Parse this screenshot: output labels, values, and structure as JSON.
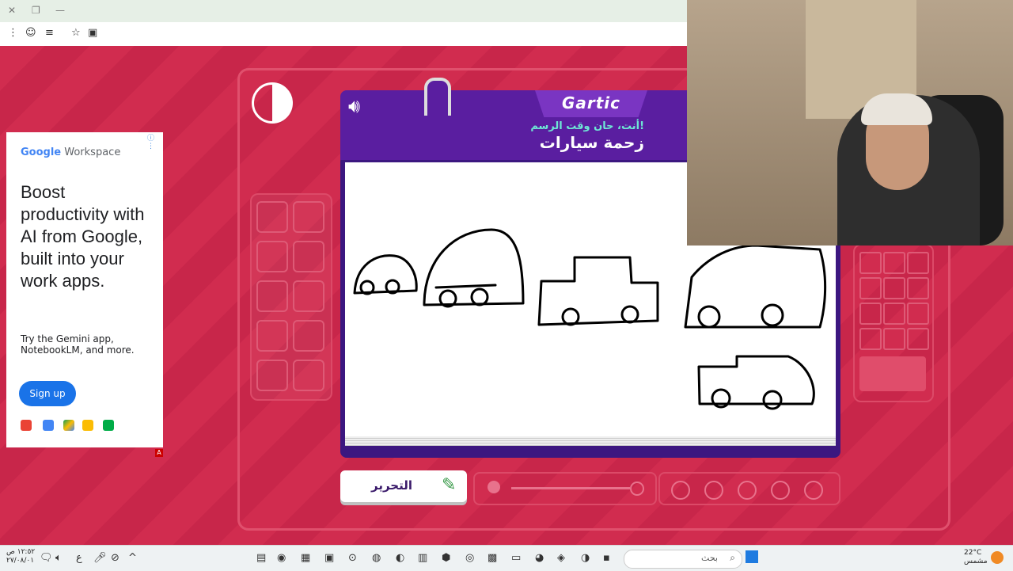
{
  "browser": {
    "toolbar_icons": [
      "menu-icon",
      "profile-icon",
      "reading-list-icon",
      "star-icon",
      "extensions-icon"
    ]
  },
  "ad": {
    "brand_google": "Google",
    "brand_product": "Workspace",
    "headline": "Boost productivity with AI from Google, built into your work apps.",
    "subtext": "Try the Gemini app, NotebookLM, and more.",
    "cta": "Sign up",
    "adchoices": "A",
    "apps": [
      "gmail-icon",
      "calendar-icon",
      "drive-icon",
      "docs-icon",
      "meet-icon"
    ]
  },
  "game": {
    "logo": "Gartic",
    "prompt": "أنت، حان وقت الرسم!",
    "word": "زحمة سيارات",
    "edit_label": "التحرير",
    "colors": {
      "accent": "#5a1ea0",
      "background": "#c9284a",
      "prompt": "#6ee7d5"
    }
  },
  "taskbar": {
    "search_placeholder": "بحث",
    "time": "١٢:٥٢ ص",
    "date": "٢٧/٠٨/٠١",
    "weather_temp": "22°C",
    "weather_desc": "مشمس",
    "lang": "ع"
  }
}
